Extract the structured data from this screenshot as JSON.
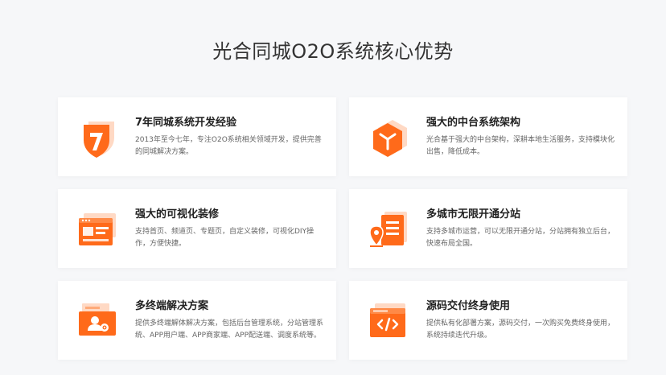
{
  "page": {
    "title": "光合同城O2O系统核心优势"
  },
  "colors": {
    "accent": "#ff6a1a",
    "accent_light": "#ffd9c4",
    "background": "#f6f7f9",
    "card": "#ffffff"
  },
  "cards": [
    {
      "icon": "shield-seven-icon",
      "title": "7年同城系统开发经验",
      "desc": "2013年至今七年，专注O2O系统相关领域开发，提供完善的同城解决方案。"
    },
    {
      "icon": "cube-architecture-icon",
      "title": "强大的中台系统架构",
      "desc": "光合基于强大的中台架构，深耕本地生活服务，支持模块化出售，降低成本。"
    },
    {
      "icon": "visual-editor-icon",
      "title": "强大的可视化装修",
      "desc": "支持首页、频道页、专题页，自定义装修，可视化DIY操作，方便快捷。"
    },
    {
      "icon": "city-station-icon",
      "title": "多城市无限开通分站",
      "desc": "支持多城市运营，可以无限开通分站，分站拥有独立后台，快速布局全国。"
    },
    {
      "icon": "multi-terminal-icon",
      "title": "多终端解决方案",
      "desc": "提供多终端解体解决方案，包括后台管理系统，分站管理系统、APP用户端、APP商家端、APP配送端、调度系统等。"
    },
    {
      "icon": "source-code-icon",
      "title": "源码交付终身使用",
      "desc": "提供私有化部署方案，源码交付，一次购买免费终身使用，系统持续迭代升级。"
    }
  ]
}
